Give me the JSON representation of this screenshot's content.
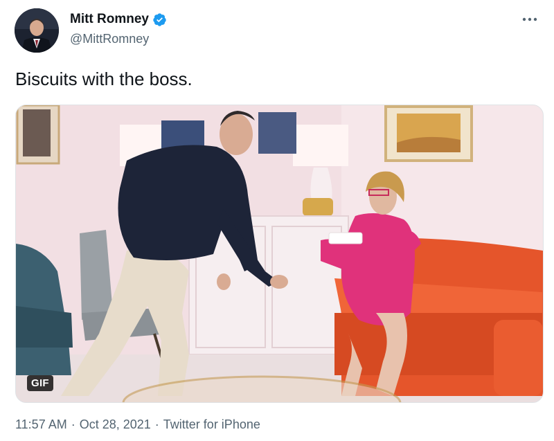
{
  "author": {
    "display_name": "Mitt Romney",
    "handle": "@MittRomney",
    "verified": true,
    "verified_color": "#1d9bf0"
  },
  "more_icon": "more-horizontal-icon",
  "tweet": {
    "text": "Biscuits with the boss."
  },
  "media": {
    "type": "GIF",
    "badge_label": "GIF"
  },
  "meta": {
    "time": "11:57 AM",
    "separator": "·",
    "date": "Oct 28, 2021",
    "source": "Twitter for iPhone"
  },
  "colors": {
    "text_primary": "#0f1419",
    "text_secondary": "#536471"
  }
}
